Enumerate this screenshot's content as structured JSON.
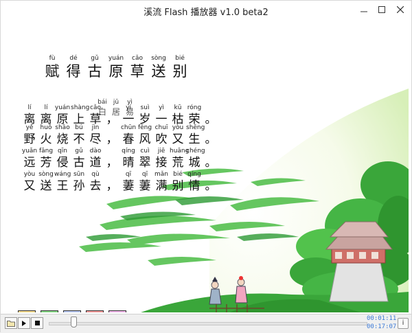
{
  "window": {
    "title": "溪流 Flash 播放器 v1.0 beta2"
  },
  "poem": {
    "title": [
      {
        "py": "fù",
        "hz": "赋"
      },
      {
        "py": "dé",
        "hz": "得"
      },
      {
        "py": "gǔ",
        "hz": "古"
      },
      {
        "py": "yuán",
        "hz": "原"
      },
      {
        "py": "cǎo",
        "hz": "草"
      },
      {
        "py": "sòng",
        "hz": "送"
      },
      {
        "py": "bié",
        "hz": "别"
      }
    ],
    "author": [
      {
        "py": "bái",
        "hz": "白"
      },
      {
        "py": "jū",
        "hz": "居"
      },
      {
        "py": "yì",
        "hz": "易"
      }
    ],
    "lines": [
      [
        {
          "py": "lí",
          "hz": "离"
        },
        {
          "py": "lí",
          "hz": "离"
        },
        {
          "py": "yuán",
          "hz": "原"
        },
        {
          "py": "shàng",
          "hz": "上"
        },
        {
          "py": "cǎo",
          "hz": "草"
        },
        {
          "py": "",
          "hz": "，"
        },
        {
          "py": "yí",
          "hz": "一"
        },
        {
          "py": "suì",
          "hz": "岁"
        },
        {
          "py": "yì",
          "hz": "一"
        },
        {
          "py": "kū",
          "hz": "枯"
        },
        {
          "py": "róng",
          "hz": "荣"
        },
        {
          "py": "",
          "hz": "。"
        }
      ],
      [
        {
          "py": "yě",
          "hz": "野"
        },
        {
          "py": "huǒ",
          "hz": "火"
        },
        {
          "py": "shāo",
          "hz": "烧"
        },
        {
          "py": "bú",
          "hz": "不"
        },
        {
          "py": "jìn",
          "hz": "尽"
        },
        {
          "py": "",
          "hz": "，"
        },
        {
          "py": "chūn",
          "hz": "春"
        },
        {
          "py": "fēng",
          "hz": "风"
        },
        {
          "py": "chuī",
          "hz": "吹"
        },
        {
          "py": "yòu",
          "hz": "又"
        },
        {
          "py": "shēng",
          "hz": "生"
        },
        {
          "py": "",
          "hz": "。"
        }
      ],
      [
        {
          "py": "yuǎn",
          "hz": "远"
        },
        {
          "py": "fāng",
          "hz": "芳"
        },
        {
          "py": "qīn",
          "hz": "侵"
        },
        {
          "py": "gǔ",
          "hz": "古"
        },
        {
          "py": "dào",
          "hz": "道"
        },
        {
          "py": "",
          "hz": "，"
        },
        {
          "py": "qíng",
          "hz": "晴"
        },
        {
          "py": "cuì",
          "hz": "翠"
        },
        {
          "py": "jiē",
          "hz": "接"
        },
        {
          "py": "huāng",
          "hz": "荒"
        },
        {
          "py": "chéng",
          "hz": "城"
        },
        {
          "py": "",
          "hz": "。"
        }
      ],
      [
        {
          "py": "yòu",
          "hz": "又"
        },
        {
          "py": "sòng",
          "hz": "送"
        },
        {
          "py": "wáng",
          "hz": "王"
        },
        {
          "py": "sūn",
          "hz": "孙"
        },
        {
          "py": "qù",
          "hz": "去"
        },
        {
          "py": "",
          "hz": "，"
        },
        {
          "py": "qī",
          "hz": "萋"
        },
        {
          "py": "qī",
          "hz": "萋"
        },
        {
          "py": "mǎn",
          "hz": "满"
        },
        {
          "py": "bié",
          "hz": "别"
        },
        {
          "py": "qíng",
          "hz": "情"
        },
        {
          "py": "",
          "hz": "。"
        }
      ]
    ]
  },
  "controls": [
    {
      "name": "triangle-button",
      "shape": "triangle",
      "fill": "#f3e07a",
      "bg": "#f6d98c"
    },
    {
      "name": "circle-button",
      "shape": "circle",
      "fill": "#3fc23f",
      "bg": "#86d886"
    },
    {
      "name": "play-triangle-button",
      "shape": "right-triangle",
      "fill": "#6f8fe6",
      "bg": "#b9c8f2"
    },
    {
      "name": "square-button",
      "shape": "square",
      "fill": "#e34a4a",
      "bg": "#f39a9a"
    },
    {
      "name": "down-triangle-button",
      "shape": "down-triangle",
      "fill": "#e676d8",
      "bg": "#f2b6ea"
    }
  ],
  "player": {
    "elapsed": "00:01:11",
    "total": "00:17:07",
    "progress": 0.069,
    "icons": {
      "open": "folder-open-icon",
      "play": "play-icon",
      "stop": "stop-icon",
      "info": "info-icon"
    },
    "info_label": "i"
  },
  "colors": {
    "accent": "#3d7ad6",
    "foliage": "#3aa63a",
    "roof": "#c9a4a0"
  }
}
